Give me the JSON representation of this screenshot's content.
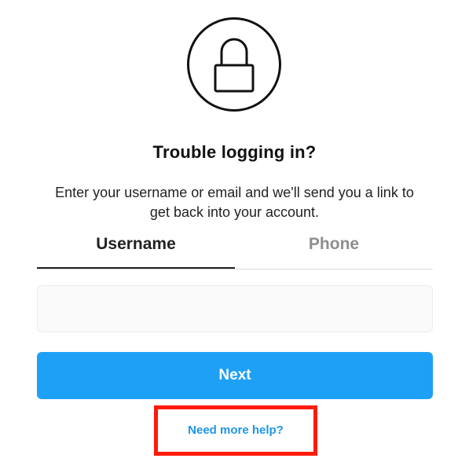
{
  "header": {
    "icon": "lock-icon",
    "title": "Trouble logging in?",
    "subtitle": "Enter your username or email and we'll send you a link to get back into your account."
  },
  "tabs": [
    {
      "label": "Username",
      "active": true
    },
    {
      "label": "Phone",
      "active": false
    }
  ],
  "form": {
    "input_value": "",
    "input_placeholder": "",
    "next_label": "Next"
  },
  "help": {
    "link_label": "Need more help?"
  },
  "colors": {
    "accent": "#1ea0f7",
    "link": "#1b95e8",
    "highlight": "#ff1a0a",
    "inactive_tab": "#8e8e8e"
  }
}
